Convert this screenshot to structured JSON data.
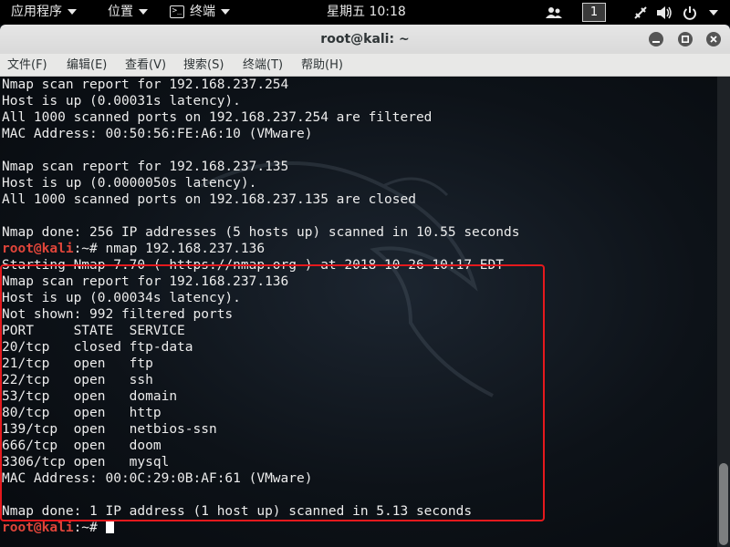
{
  "topbar": {
    "apps_menu": "应用程序",
    "places_menu": "位置",
    "terminal_menu": "终端",
    "clock": "星期五 10:18",
    "workspace": "1"
  },
  "window": {
    "title": "root@kali: ~",
    "menu": [
      "文件(F)",
      "编辑(E)",
      "查看(V)",
      "搜索(S)",
      "终端(T)",
      "帮助(H)"
    ]
  },
  "terminal": {
    "lines": [
      "Nmap scan report for 192.168.237.254",
      "Host is up (0.00031s latency).",
      "All 1000 scanned ports on 192.168.237.254 are filtered",
      "MAC Address: 00:50:56:FE:A6:10 (VMware)",
      "",
      "Nmap scan report for 192.168.237.135",
      "Host is up (0.0000050s latency).",
      "All 1000 scanned ports on 192.168.237.135 are closed",
      "",
      "Nmap done: 256 IP addresses (5 hosts up) scanned in 10.55 seconds"
    ],
    "prompt_user": "root@kali",
    "prompt_suffix": ":~# ",
    "command": "nmap 192.168.237.136",
    "output": [
      "Starting Nmap 7.70 ( https://nmap.org ) at 2018-10-26 10:17 EDT",
      "Nmap scan report for 192.168.237.136",
      "Host is up (0.00034s latency).",
      "Not shown: 992 filtered ports",
      "PORT     STATE  SERVICE",
      "20/tcp   closed ftp-data",
      "21/tcp   open   ftp",
      "22/tcp   open   ssh",
      "53/tcp   open   domain",
      "80/tcp   open   http",
      "139/tcp  open   netbios-ssn",
      "666/tcp  open   doom",
      "3306/tcp open   mysql",
      "MAC Address: 00:0C:29:0B:AF:61 (VMware)",
      "",
      "Nmap done: 1 IP address (1 host up) scanned in 5.13 seconds"
    ],
    "final_prompt_user": "root@kali",
    "final_prompt_suffix": ":~# "
  },
  "colors": {
    "prompt": "#e0453a",
    "highlight_box": "#e5191d"
  }
}
